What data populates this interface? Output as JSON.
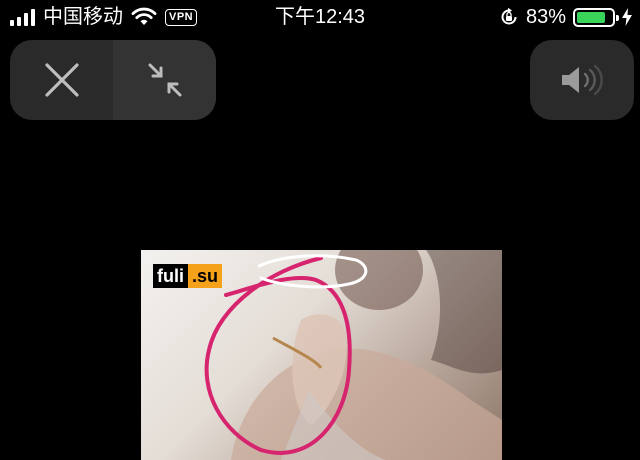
{
  "status_bar": {
    "carrier": "中国移动",
    "vpn_label": "VPN",
    "time": "下午12:43",
    "battery_percent": "83%",
    "battery_level": 0.83,
    "battery_color": "#3ad35a"
  },
  "controls": {
    "close_icon": "close-icon",
    "collapse_icon": "collapse-arrows-icon",
    "volume_icon": "speaker-icon"
  },
  "video": {
    "watermark_part1": "fuli",
    "watermark_part2": ".su",
    "annotation_color": "#d6246e"
  }
}
